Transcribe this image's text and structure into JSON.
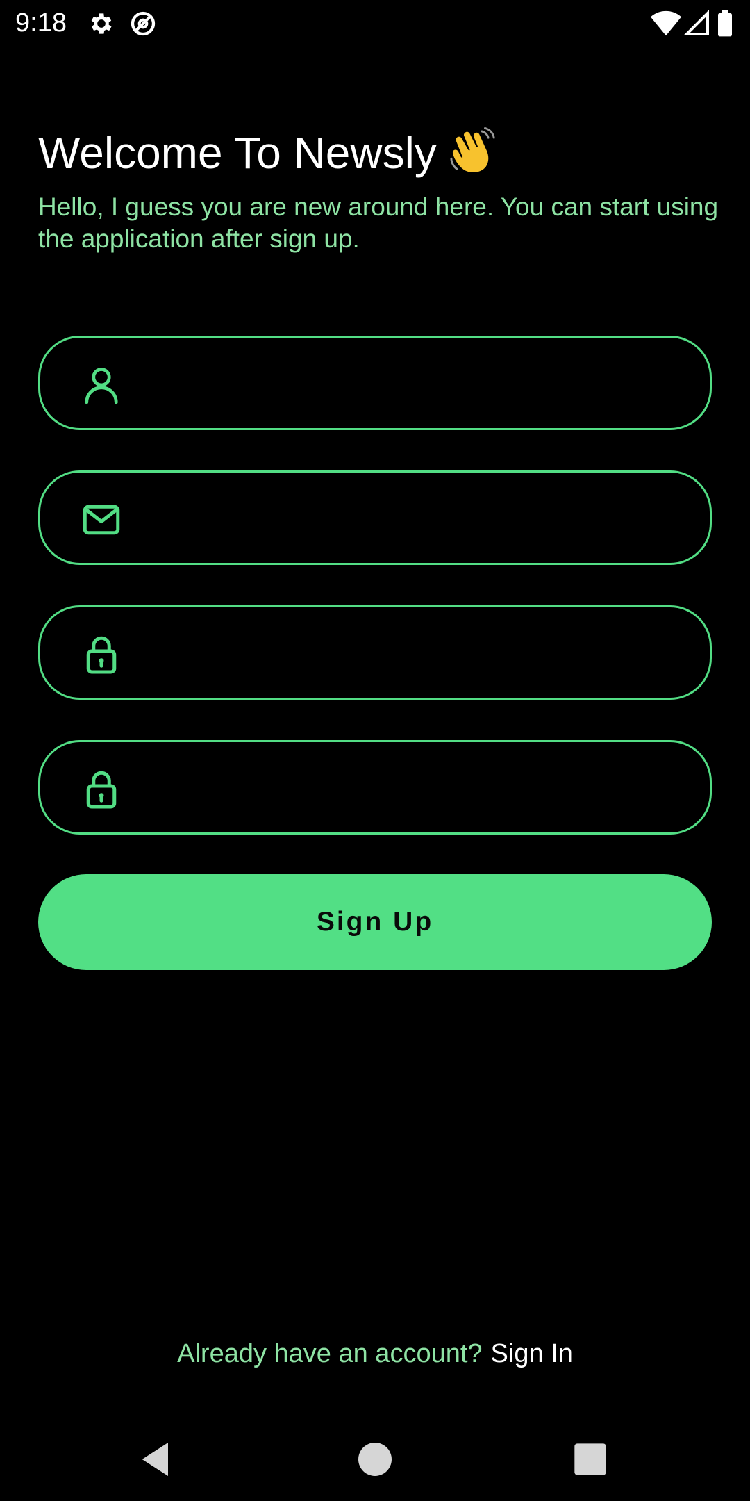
{
  "status_bar": {
    "time": "9:18",
    "icons": [
      "gear-icon",
      "at-sign-icon",
      "wifi-icon",
      "signal-icon",
      "battery-icon"
    ]
  },
  "header": {
    "title": "Welcome To Newsly",
    "title_emoji": "waving-hand-icon",
    "subtitle": "Hello, I guess you are new around here. You can start using the application after sign up."
  },
  "form": {
    "fields": [
      {
        "icon": "user-icon",
        "value": "",
        "placeholder": ""
      },
      {
        "icon": "mail-icon",
        "value": "",
        "placeholder": ""
      },
      {
        "icon": "lock-icon",
        "value": "",
        "placeholder": ""
      },
      {
        "icon": "lock-icon",
        "value": "",
        "placeholder": ""
      }
    ],
    "submit_label": "Sign Up"
  },
  "footer": {
    "question": "Already have an account?",
    "link_label": "Sign In"
  },
  "nav_bar": {
    "buttons": [
      "back-icon",
      "home-icon",
      "recents-icon"
    ]
  },
  "colors": {
    "background": "#000000",
    "accent": "#52df85",
    "muted_text": "#8ee3a4",
    "text": "#ffffff"
  }
}
